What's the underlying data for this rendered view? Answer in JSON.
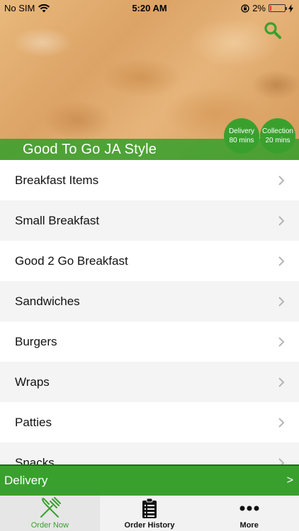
{
  "status_bar": {
    "carrier": "No SIM",
    "time": "5:20 AM",
    "battery": "2%"
  },
  "header": {
    "restaurant_name": "Good To Go JA Style",
    "search_icon": "search-icon",
    "delivery_badge": {
      "label": "Delivery",
      "time": "80 mins"
    },
    "collection_badge": {
      "label": "Collection",
      "time": "20 mins"
    }
  },
  "menu": {
    "items": [
      {
        "label": "Breakfast Items"
      },
      {
        "label": "Small Breakfast"
      },
      {
        "label": "Good 2 Go Breakfast"
      },
      {
        "label": "Sandwiches"
      },
      {
        "label": "Burgers"
      },
      {
        "label": "Wraps"
      },
      {
        "label": "Patties"
      },
      {
        "label": "Snacks"
      }
    ]
  },
  "order_mode": {
    "label": "Delivery",
    "arrow": ">"
  },
  "tabs": [
    {
      "label": "Order Now",
      "icon": "fork-knife-icon",
      "active": true
    },
    {
      "label": "Order History",
      "icon": "clipboard-icon",
      "active": false
    },
    {
      "label": "More",
      "icon": "more-dots-icon",
      "active": false
    }
  ],
  "colors": {
    "accent": "#39a02e",
    "tab_bar": "#f2f2f2"
  }
}
